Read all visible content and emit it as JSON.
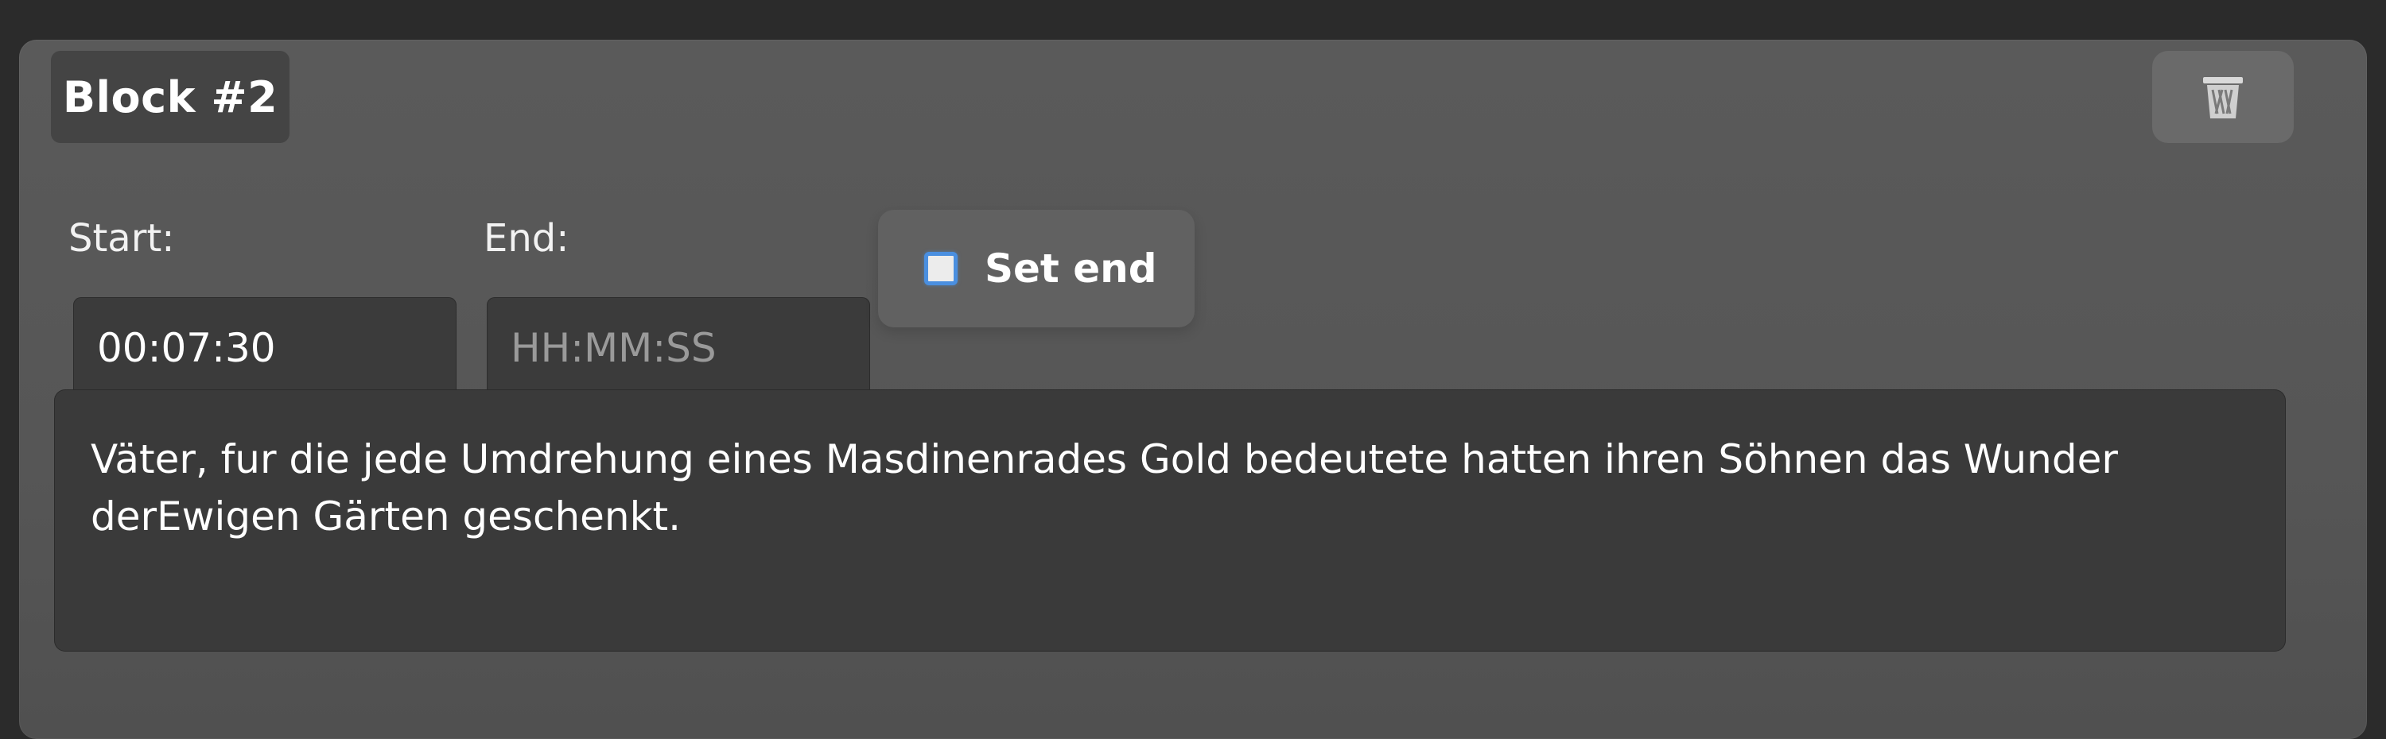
{
  "block": {
    "title": "Block #2",
    "delete_icon": "trash-icon"
  },
  "start": {
    "label": "Start:",
    "value": "00:07:30"
  },
  "end": {
    "label": "End:",
    "value": "",
    "placeholder": "HH:MM:SS"
  },
  "set_end": {
    "label": "Set end",
    "checked": false
  },
  "text": {
    "content": "Väter, fur die jede Umdrehung eines Masdinenrades Gold bedeutete hatten ihren Söhnen das Wunder derEwigen Gärten geschenkt."
  },
  "colors": {
    "background": "#2b2b2b",
    "panel": "#565656",
    "field": "#3b3b3b",
    "checkbox_accent": "#4a8fe0"
  }
}
